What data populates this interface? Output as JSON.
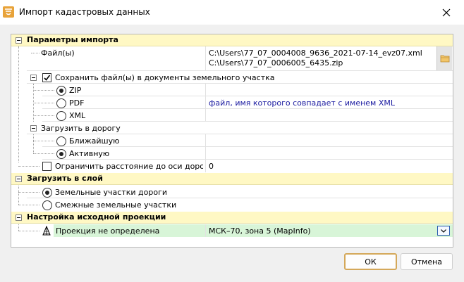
{
  "window": {
    "title": "Импорт кадастровых данных"
  },
  "sections": {
    "import_params": {
      "label": "Параметры импорта",
      "files": {
        "label": "Файл(ы)",
        "paths": [
          "C:\\Users\\77_07_0004008_9636_2021-07-14_evz07.xml",
          "C:\\Users\\77_07_0006005_6435.zip"
        ]
      },
      "save_files": {
        "label": "Сохранить файл(ы) в документы земельного участка",
        "checked": true,
        "options": [
          {
            "label": "ZIP",
            "selected": true,
            "value": ""
          },
          {
            "label": "PDF",
            "selected": false,
            "value": "файл, имя которого совпадает с именем XML"
          },
          {
            "label": "XML",
            "selected": false,
            "value": ""
          }
        ]
      },
      "load_road": {
        "label": "Загрузить в дорогу",
        "options": [
          {
            "label": "Ближайшую",
            "selected": false
          },
          {
            "label": "Активную",
            "selected": true
          }
        ]
      },
      "limit_distance": {
        "label": "Ограничить расстояние до оси дороги, м",
        "checked": false,
        "value": "0"
      }
    },
    "load_layer": {
      "label": "Загрузить в слой",
      "options": [
        {
          "label": "Земельные участки дороги",
          "selected": true
        },
        {
          "label": "Смежные земельные участки",
          "selected": false
        }
      ]
    },
    "projection": {
      "label": "Настройка исходной проекции",
      "row_label": "Проекция не определена",
      "value": "МСК–70, зона 5 (MapInfo)"
    }
  },
  "buttons": {
    "ok": "ОК",
    "cancel": "Отмена"
  },
  "colors": {
    "category_bg": "#fff8c4",
    "projection_bg": "#d8f5d8",
    "link_text": "#1a1aa0"
  }
}
